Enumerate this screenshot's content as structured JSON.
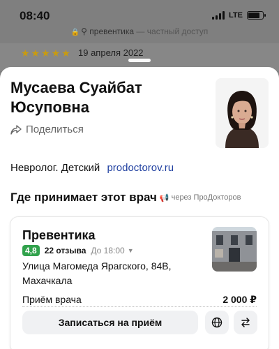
{
  "status_bar": {
    "time": "08:40",
    "network": "LTE"
  },
  "browser": {
    "site": "превентика",
    "separator": "—",
    "access": "частный доступ"
  },
  "background_review": {
    "stars": 5,
    "stars_text": "★★★★★",
    "date": "19 апреля 2022"
  },
  "doctor": {
    "name": "Мусаева Суайбат Юсуповна",
    "share_label": "Поделиться",
    "specialty": "Невролог. Детский",
    "source_link": "prodoctorov.ru"
  },
  "where_section": {
    "title": "Где принимает этот врач",
    "via": "через ПроДокторов"
  },
  "clinic": {
    "name": "Превентика",
    "rating": "4,8",
    "reviews": "22 отзыва",
    "hours": "До 18:00",
    "address": "Улица Магомеда Ярагского, 84В, Махачкала",
    "price_label": "Приём врача",
    "price_value": "2 000 ₽",
    "book_label": "Записаться на приём"
  },
  "colors": {
    "rating_green": "#31a24c",
    "link_blue": "#1f3fa0",
    "stars_gold": "#c89b10",
    "button_bg": "#f0f1f3"
  },
  "icons": {
    "share": "share-arrow-icon",
    "globe": "globe-icon",
    "transfer": "transfer-arrows-icon",
    "lock": "lock-icon",
    "search": "search-icon",
    "megaphone": "megaphone-icon"
  }
}
